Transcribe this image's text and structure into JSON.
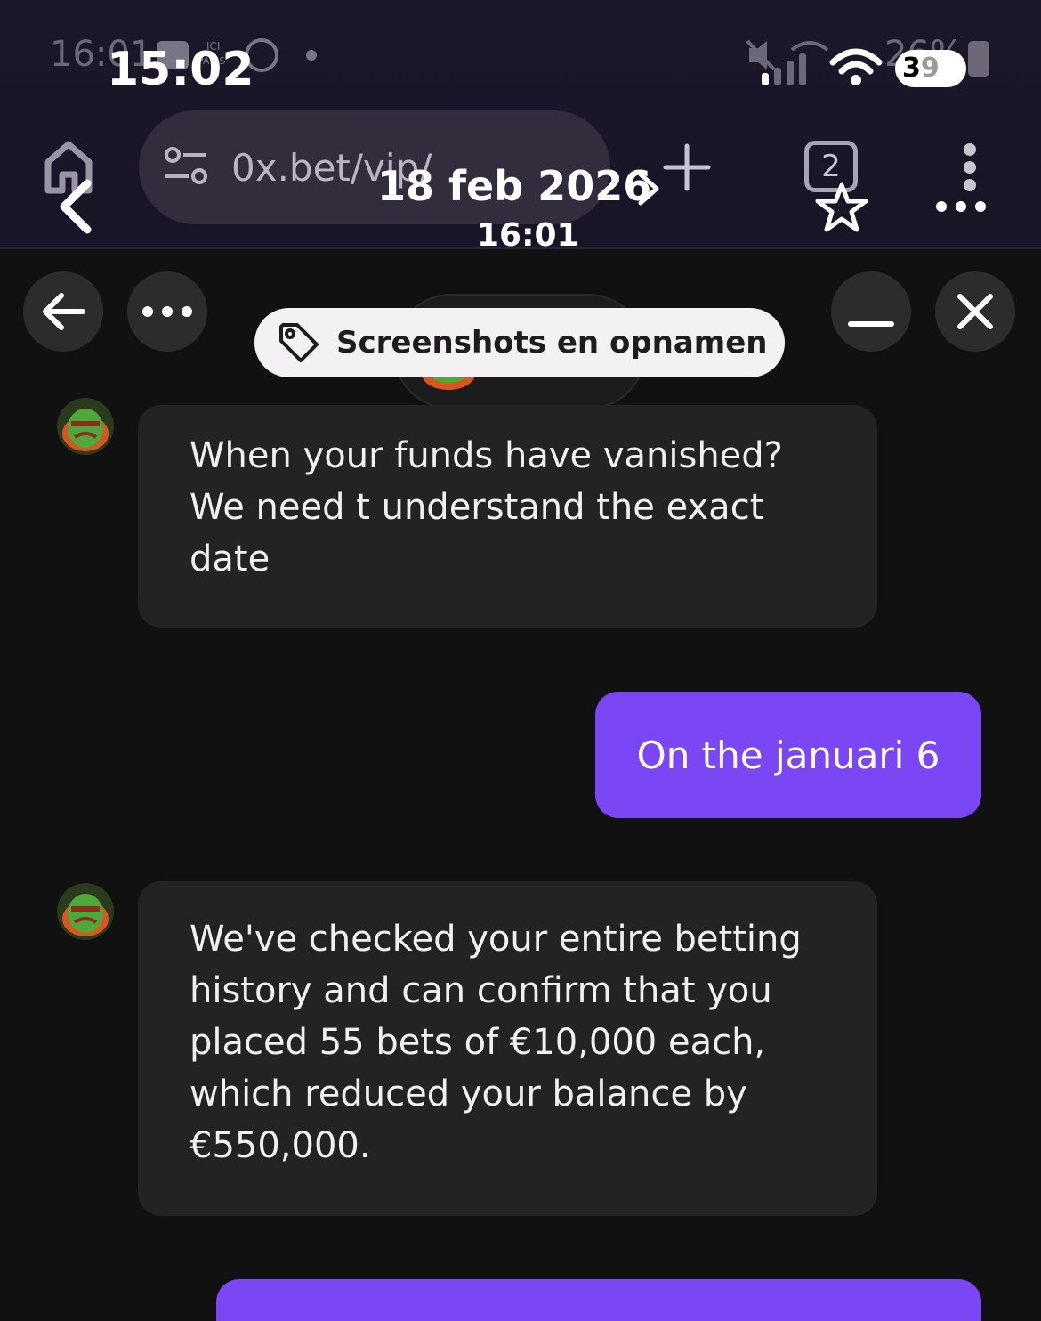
{
  "status_bar": {
    "time_overlay": "15:02",
    "time_behind": "16:01",
    "battery_overlay": "3",
    "battery_overlay_dim": "9",
    "battery_behind": "26%"
  },
  "browser": {
    "url": "0x.bet/vip/",
    "tab_count": "2",
    "date": "18 feb 2026",
    "time": "16:01"
  },
  "chat_header": {
    "tag_label": "Screenshots en opnamen"
  },
  "messages": [
    {
      "from": "support",
      "lines": [
        "When your funds have vanished?",
        "We need t understand the exact",
        "date"
      ]
    },
    {
      "from": "user",
      "text": "On the januari 6"
    },
    {
      "from": "support",
      "lines": [
        "We've checked your entire betting",
        "history and can confirm that you",
        "placed 55 bets of €10,000 each,",
        "which reduced your balance by",
        "€550,000."
      ]
    }
  ],
  "colors": {
    "accent": "#7b47f5",
    "incoming_bubble": "#232323",
    "background": "#111111"
  }
}
